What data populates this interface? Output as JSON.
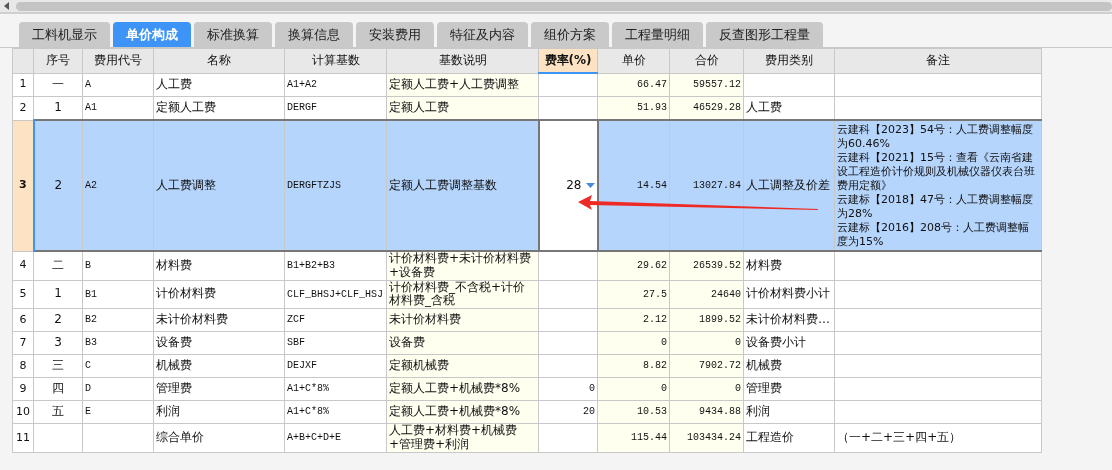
{
  "tabs": [
    {
      "label": "工料机显示",
      "selected": false
    },
    {
      "label": "单价构成",
      "selected": true
    },
    {
      "label": "标准换算",
      "selected": false
    },
    {
      "label": "换算信息",
      "selected": false
    },
    {
      "label": "安装费用",
      "selected": false
    },
    {
      "label": "特征及内容",
      "selected": false
    },
    {
      "label": "组价方案",
      "selected": false
    },
    {
      "label": "工程量明细",
      "selected": false
    },
    {
      "label": "反查图形工程量",
      "selected": false
    }
  ],
  "table": {
    "columns": [
      {
        "label": "序号",
        "focused": false
      },
      {
        "label": "费用代号",
        "focused": false
      },
      {
        "label": "名称",
        "focused": false
      },
      {
        "label": "计算基数",
        "focused": false
      },
      {
        "label": "基数说明",
        "focused": false
      },
      {
        "label": "费率(%)",
        "focused": true
      },
      {
        "label": "单价",
        "focused": false
      },
      {
        "label": "合价",
        "focused": false
      },
      {
        "label": "费用类别",
        "focused": false
      },
      {
        "label": "备注",
        "focused": false
      }
    ],
    "rows": [
      {
        "number": "1",
        "selected": false,
        "editing": false,
        "cells": [
          "一",
          "A",
          "人工费",
          "A1+A2",
          "定额人工费+人工费调整",
          "",
          "66.47",
          "59557.12",
          "",
          ""
        ],
        "remarks": []
      },
      {
        "number": "2",
        "selected": false,
        "editing": false,
        "cells": [
          "1",
          "A1",
          "定额人工费",
          "DERGF",
          "定额人工费",
          "",
          "51.93",
          "46529.28",
          "人工费",
          ""
        ],
        "remarks": []
      },
      {
        "number": "3",
        "selected": true,
        "editing": true,
        "cells": [
          "2",
          "A2",
          "人工费调整",
          "DERGFTZJS",
          "定额人工费调整基数",
          "28",
          "14.54",
          "13027.84",
          "人工调整及价差",
          ""
        ],
        "remarks": [
          "云建科【2023】54号：人工费调整幅度为60.46%",
          "云建科【2021】15号：查看《云南省建设工程造价计价规则及机械仪器仪表台班费用定额》",
          "云建标【2018】47号：人工费调整幅度为28%",
          "云建标【2016】208号：人工费调整幅度为15%"
        ]
      },
      {
        "number": "4",
        "selected": false,
        "editing": false,
        "cells": [
          "二",
          "B",
          "材料费",
          "B1+B2+B3",
          "计价材料费+未计价材料费+设备费",
          "",
          "29.62",
          "26539.52",
          "材料费",
          ""
        ],
        "remarks": []
      },
      {
        "number": "5",
        "selected": false,
        "editing": false,
        "cells": [
          "1",
          "B1",
          "计价材料费",
          "CLF_BHSJ+CLF_HSJ",
          "计价材料费_不含税+计价材料费_含税",
          "",
          "27.5",
          "24640",
          "计价材料费小计",
          ""
        ],
        "remarks": []
      },
      {
        "number": "6",
        "selected": false,
        "editing": false,
        "cells": [
          "2",
          "B2",
          "未计价材料费",
          "ZCF",
          "未计价材料费",
          "",
          "2.12",
          "1899.52",
          "未计价材料费…",
          ""
        ],
        "remarks": []
      },
      {
        "number": "7",
        "selected": false,
        "editing": false,
        "cells": [
          "3",
          "B3",
          "设备费",
          "SBF",
          "设备费",
          "",
          "0",
          "0",
          "设备费小计",
          ""
        ],
        "remarks": []
      },
      {
        "number": "8",
        "selected": false,
        "editing": false,
        "cells": [
          "三",
          "C",
          "机械费",
          "DEJXF",
          "定额机械费",
          "",
          "8.82",
          "7902.72",
          "机械费",
          ""
        ],
        "remarks": []
      },
      {
        "number": "9",
        "selected": false,
        "editing": false,
        "cells": [
          "四",
          "D",
          "管理费",
          "A1+C*8%",
          "定额人工费+机械费*8%",
          "0",
          "0",
          "0",
          "管理费",
          ""
        ],
        "remarks": []
      },
      {
        "number": "10",
        "selected": false,
        "editing": false,
        "cells": [
          "五",
          "E",
          "利润",
          "A1+C*8%",
          "定额人工费+机械费*8%",
          "20",
          "10.53",
          "9434.88",
          "利润",
          ""
        ],
        "remarks": []
      },
      {
        "number": "11",
        "selected": false,
        "editing": false,
        "cells": [
          "",
          "",
          "综合单价",
          "A+B+C+D+E",
          "人工费+材料费+机械费+管理费+利润",
          "",
          "115.44",
          "103434.24",
          "工程造价",
          "（一+二+三+四+五）"
        ],
        "remarks": []
      }
    ]
  }
}
